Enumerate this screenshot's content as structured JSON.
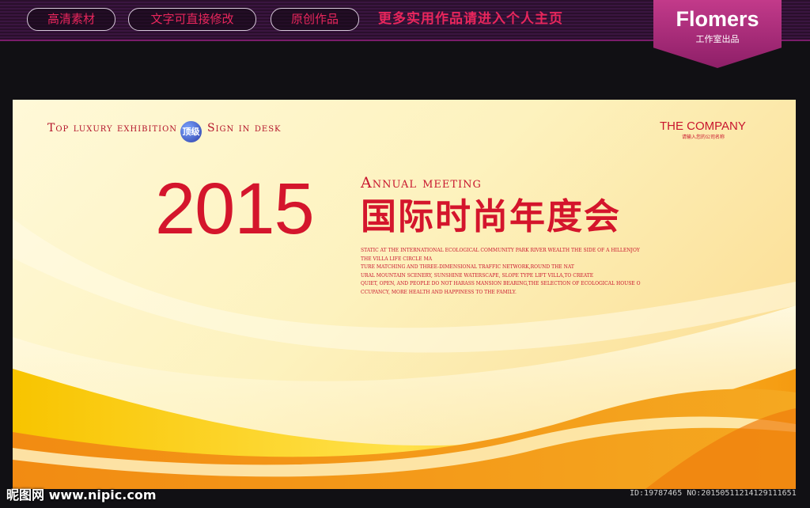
{
  "topbar": {
    "pills": [
      "高清素材",
      "文字可直接修改",
      "原创作品"
    ],
    "promo": "更多实用作品请进入个人主页",
    "brand_title": "Flomers",
    "brand_sub": "工作室出品"
  },
  "banner": {
    "tagline_left": "Top luxury exhibition",
    "badge": "顶级",
    "tagline_right": "Sign in desk",
    "company": "THE COMPANY",
    "company_sub": "请输入您的公司名称",
    "year": "2015",
    "annual": "Annual meeting",
    "cn_title": "国际时尚年度会",
    "desc_lines": [
      "STATIC AT THE INTERNATIONAL ECOLOGICAL COMMUNITY PARK RIVER WEALTH THE SIDE OF A HILLENJOY",
      "THE VILLA LIFE CIRCLE MA",
      "TURE MATCHING AND THREE-DIMENSIONAL TRAFFIC NETWORK,ROUND THE NAT",
      "URAL MOUNTAIN SCENERY, SUNSHINE WATERSCAPE, SLOPE TYPE LIFT VILLA,TO CREATE",
      "QUIET, OPEN, AND PEOPLE DO NOT HARASS MANSION BEARING,THE SELECTION OF ECOLOGICAL HOUSE O",
      "CCUPANCY, MORE HEALTH AND HAPPINESS TO THE FAMILY."
    ]
  },
  "watermark": {
    "left": "昵图网 www.nipic.com",
    "right": "ID:19787465 NO:20150511214129111651"
  },
  "colors": {
    "accent_red": "#d4152c",
    "pill_text": "#e8265c",
    "brand_bg": "#a52a7a"
  }
}
